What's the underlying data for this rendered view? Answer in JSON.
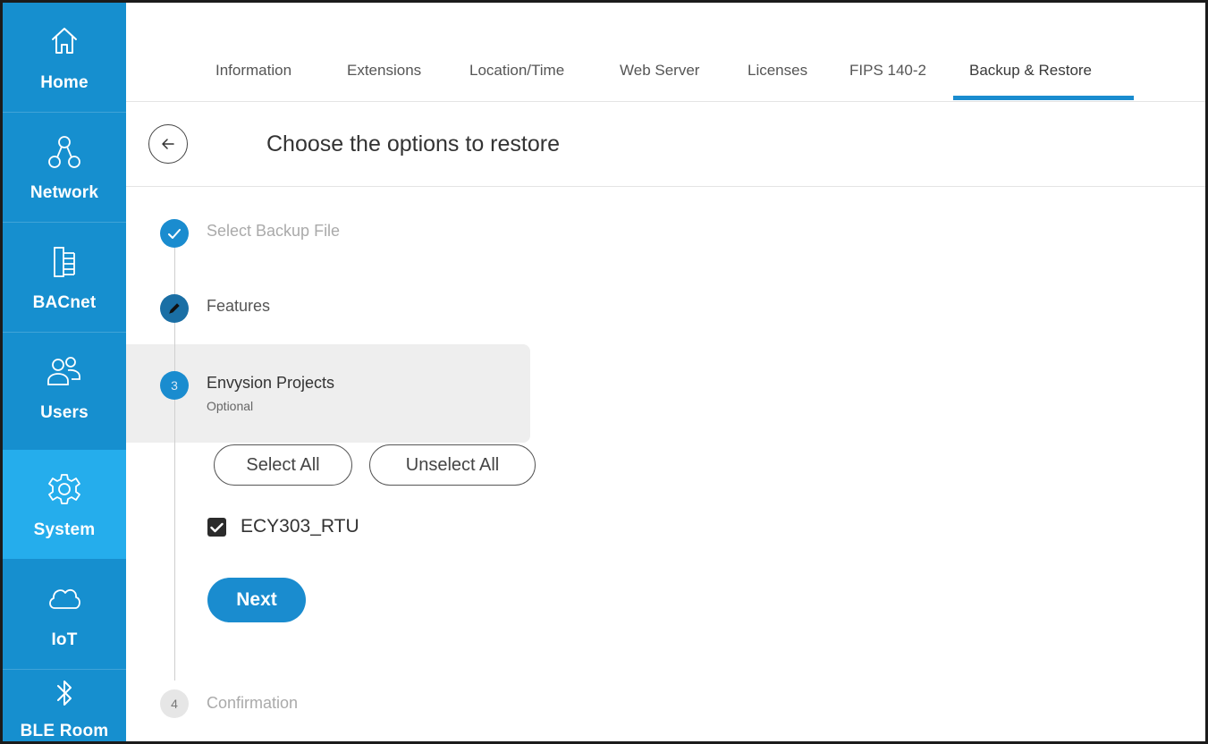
{
  "sidebar": {
    "items": [
      {
        "label": "Home",
        "icon": "home-icon"
      },
      {
        "label": "Network",
        "icon": "network-icon"
      },
      {
        "label": "BACnet",
        "icon": "bacnet-icon"
      },
      {
        "label": "Users",
        "icon": "users-icon"
      },
      {
        "label": "System",
        "icon": "gear-icon",
        "active": true
      },
      {
        "label": "IoT",
        "icon": "cloud-icon"
      },
      {
        "label": "BLE Room",
        "icon": "bluetooth-icon"
      }
    ]
  },
  "tabs": [
    {
      "label": "Information"
    },
    {
      "label": "Extensions"
    },
    {
      "label": "Location/Time"
    },
    {
      "label": "Web Server"
    },
    {
      "label": "Licenses"
    },
    {
      "label": "FIPS 140-2"
    },
    {
      "label": "Backup & Restore",
      "active": true
    }
  ],
  "header": {
    "title": "Choose the options to restore",
    "back_icon": "arrow-left-icon"
  },
  "steps": [
    {
      "label": "Select Backup File",
      "state": "done",
      "icon": "check-icon"
    },
    {
      "label": "Features",
      "state": "edit",
      "icon": "pencil-icon"
    },
    {
      "number": "3",
      "label": "Envysion Projects",
      "sublabel": "Optional",
      "state": "current"
    },
    {
      "number": "4",
      "label": "Confirmation",
      "state": "pending"
    }
  ],
  "actions": {
    "select_all": "Select All",
    "unselect_all": "Unselect All",
    "next": "Next"
  },
  "projects": [
    {
      "label": "ECY303_RTU",
      "checked": true
    }
  ],
  "colors": {
    "sidebar": "#168fcf",
    "sidebar_active": "#25adec",
    "accent": "#1a8ccf"
  }
}
